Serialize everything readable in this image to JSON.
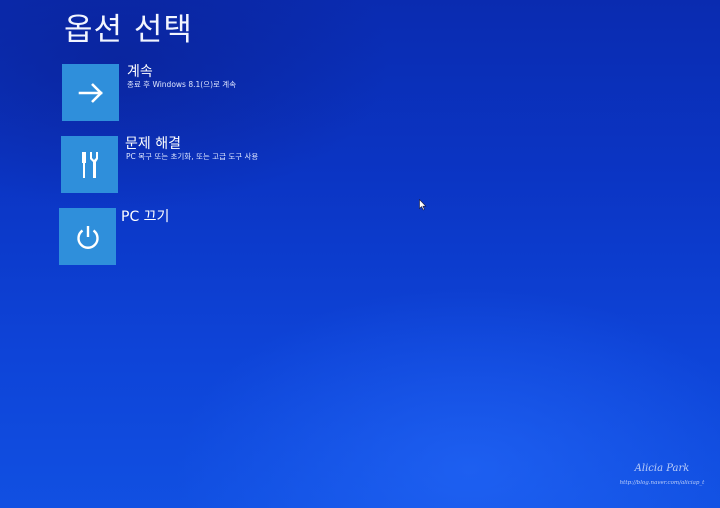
{
  "screen": {
    "title": "옵션 선택"
  },
  "options": [
    {
      "id": "continue",
      "label": "계속",
      "description": "종료 후 Windows 8.1(으)로 계속",
      "icon": "arrow-right-icon"
    },
    {
      "id": "troubleshoot",
      "label": "문제 해결",
      "description": "PC 복구 또는 초기화, 또는 고급 도구 사용",
      "icon": "tools-icon"
    },
    {
      "id": "shutdown",
      "label": "PC 끄기",
      "description": "",
      "icon": "power-icon"
    }
  ],
  "watermark": {
    "name": "Alicia Park",
    "url": "http://blog.naver.com/aliciap_t"
  },
  "colors": {
    "background": "#0b35c4",
    "tile": "#2f8fdb",
    "text": "#ffffff"
  }
}
